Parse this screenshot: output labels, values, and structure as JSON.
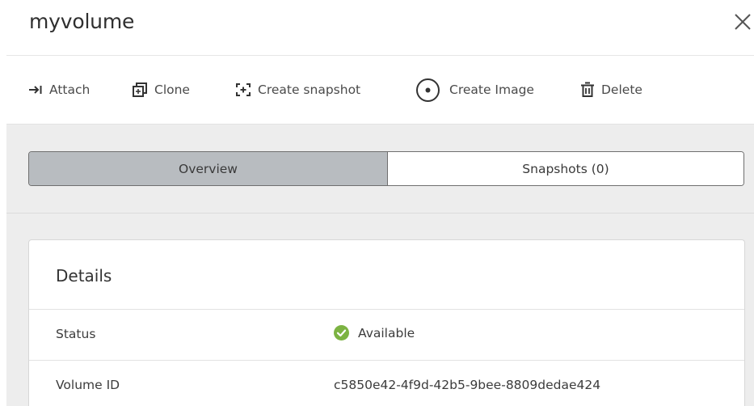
{
  "panel": {
    "title": "myvolume",
    "close_icon": "close-icon"
  },
  "toolbar": {
    "actions": [
      {
        "label": "Attach",
        "icon": "attach-icon"
      },
      {
        "label": "Clone",
        "icon": "clone-icon"
      },
      {
        "label": "Create snapshot",
        "icon": "snapshot-icon"
      },
      {
        "label": "Create Image",
        "icon": "image-disc-icon"
      },
      {
        "label": "Delete",
        "icon": "trash-icon"
      }
    ]
  },
  "tabs": [
    {
      "label": "Overview",
      "active": true
    },
    {
      "label": "Snapshots (0)",
      "active": false
    }
  ],
  "details": {
    "title": "Details",
    "rows": [
      {
        "label": "Status",
        "value": "Available",
        "status_icon": "check-circle-icon",
        "status_color": "#7cb342"
      },
      {
        "label": "Volume ID",
        "value": "c5850e42-4f9d-42b5-9bee-8809dedae424"
      }
    ]
  },
  "colors": {
    "active_tab_bg": "#b8bcc0",
    "content_bg": "#ededed",
    "status_available": "#7cb342"
  }
}
